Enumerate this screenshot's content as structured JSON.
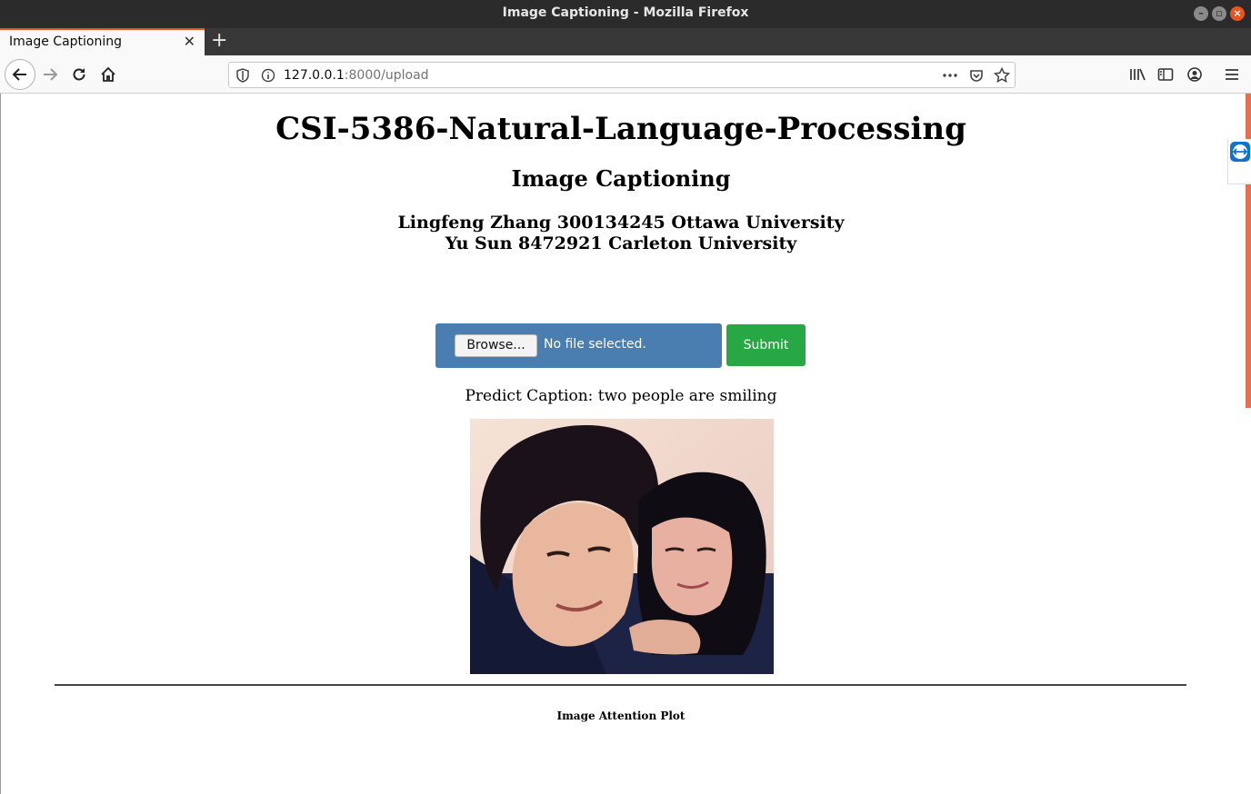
{
  "window": {
    "title": "Image Captioning - Mozilla Firefox",
    "controls": [
      "minimize-icon",
      "maximize-icon",
      "close-icon"
    ]
  },
  "tabs": [
    {
      "label": "Image Captioning",
      "active": true
    }
  ],
  "toolbar": {
    "url_host": "127.0.0.1",
    "url_path": ":8000/upload",
    "icons": [
      "back-arrow-icon",
      "forward-arrow-icon",
      "reload-icon",
      "home-icon",
      "shield-icon",
      "info-icon",
      "more-actions-icon",
      "pocket-icon",
      "bookmark-star-icon",
      "library-icon",
      "sidebar-icon",
      "account-icon",
      "hamburger-menu-icon"
    ]
  },
  "page": {
    "title": "CSI-5386-Natural-Language-Processing",
    "subtitle": "Image Captioning",
    "authors": [
      "Lingfeng Zhang 300134245 Ottawa University",
      "Yu Sun 8472921 Carleton University"
    ],
    "upload": {
      "browse_label": "Browse...",
      "file_status": "No file selected.",
      "submit_label": "Submit"
    },
    "caption": "Predict Caption: two people are smiling",
    "attention_title": "Image Attention Plot"
  },
  "colors": {
    "file_box": "#4a7eb0",
    "submit": "#28a745",
    "tab_accent": "#e95420",
    "scrollbar": "#e27055"
  }
}
